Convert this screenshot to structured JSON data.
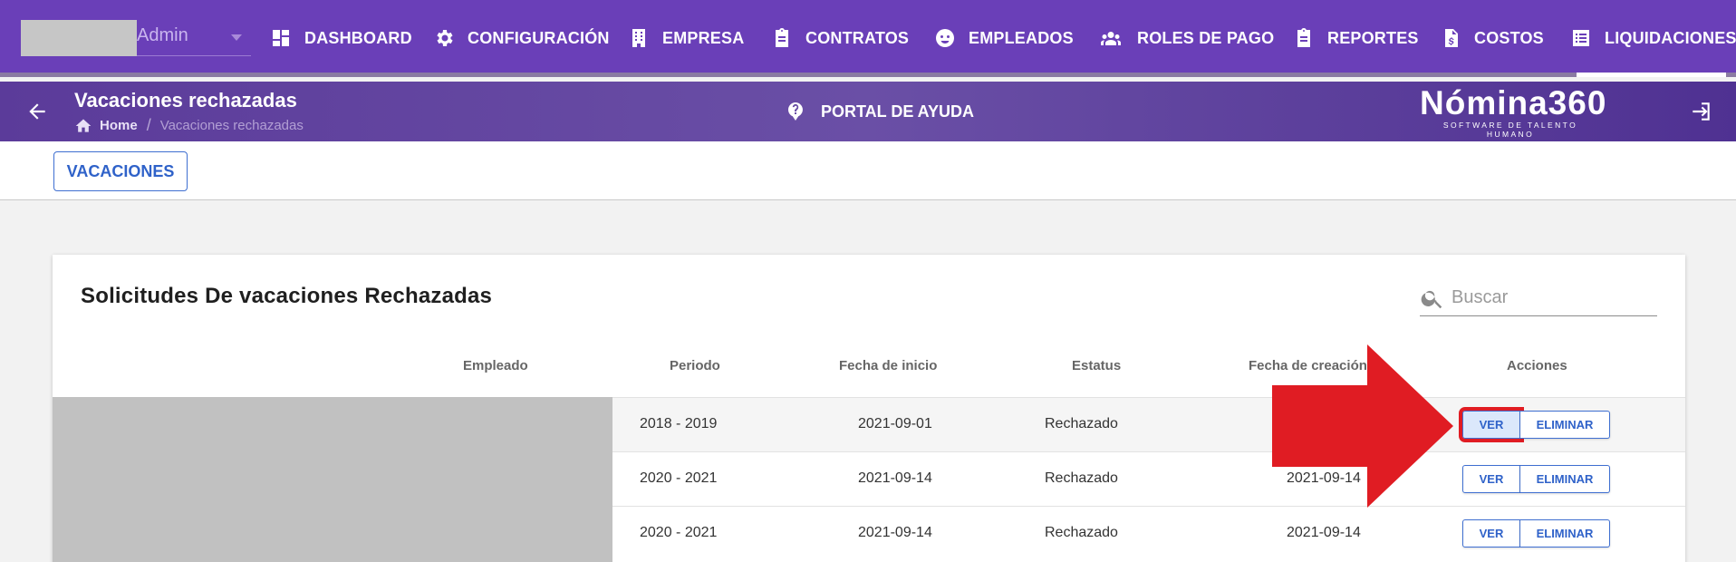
{
  "topnav": {
    "user": {
      "name": "Admin"
    },
    "items": [
      {
        "id": "dashboard",
        "label": "DASHBOARD",
        "icon": "dashboard-icon"
      },
      {
        "id": "configuracion",
        "label": "CONFIGURACIÓN",
        "icon": "gear-icon"
      },
      {
        "id": "empresa",
        "label": "EMPRESA",
        "icon": "building-icon"
      },
      {
        "id": "contratos",
        "label": "CONTRATOS",
        "icon": "clipboard-icon"
      },
      {
        "id": "empleados",
        "label": "EMPLEADOS",
        "icon": "face-icon"
      },
      {
        "id": "roles",
        "label": "ROLES DE PAGO",
        "icon": "people-icon"
      },
      {
        "id": "reportes",
        "label": "REPORTES",
        "icon": "clipboard-icon"
      },
      {
        "id": "costos",
        "label": "COSTOS",
        "icon": "dollar-file-icon"
      },
      {
        "id": "liquidaciones",
        "label": "LIQUIDACIONES",
        "icon": "list-icon"
      }
    ]
  },
  "subheader": {
    "title": "Vacaciones rechazadas",
    "breadcrumb": {
      "home": "Home",
      "separator": "/",
      "current": "Vacaciones rechazadas"
    },
    "help_label": "PORTAL DE AYUDA",
    "logo_main": "Nómina360",
    "logo_sub": "SOFTWARE DE TALENTO HUMANO"
  },
  "toolbar": {
    "vacaciones_label": "VACACIONES"
  },
  "card": {
    "title": "Solicitudes De vacaciones Rechazadas",
    "search_placeholder": "Buscar",
    "columns": {
      "empleado": "Empleado",
      "periodo": "Periodo",
      "fecha_inicio": "Fecha de inicio",
      "estatus": "Estatus",
      "fecha_creacion": "Fecha de creación",
      "acciones": "Acciones"
    },
    "rows": [
      {
        "periodo": "2018 - 2019",
        "fecha_inicio": "2021-09-01",
        "estatus": "Rechazado",
        "fecha_creacion": "",
        "ver": "VER",
        "eliminar": "ELIMINAR"
      },
      {
        "periodo": "2020 - 2021",
        "fecha_inicio": "2021-09-14",
        "estatus": "Rechazado",
        "fecha_creacion": "2021-09-14",
        "ver": "VER",
        "eliminar": "ELIMINAR"
      },
      {
        "periodo": "2020 - 2021",
        "fecha_inicio": "2021-09-14",
        "estatus": "Rechazado",
        "fecha_creacion": "2021-09-14",
        "ver": "VER",
        "eliminar": "ELIMINAR"
      }
    ]
  },
  "colors": {
    "nav_bg": "#6a3fb8",
    "accent_blue": "#2f62c9",
    "annotation_red": "#e01c23"
  }
}
